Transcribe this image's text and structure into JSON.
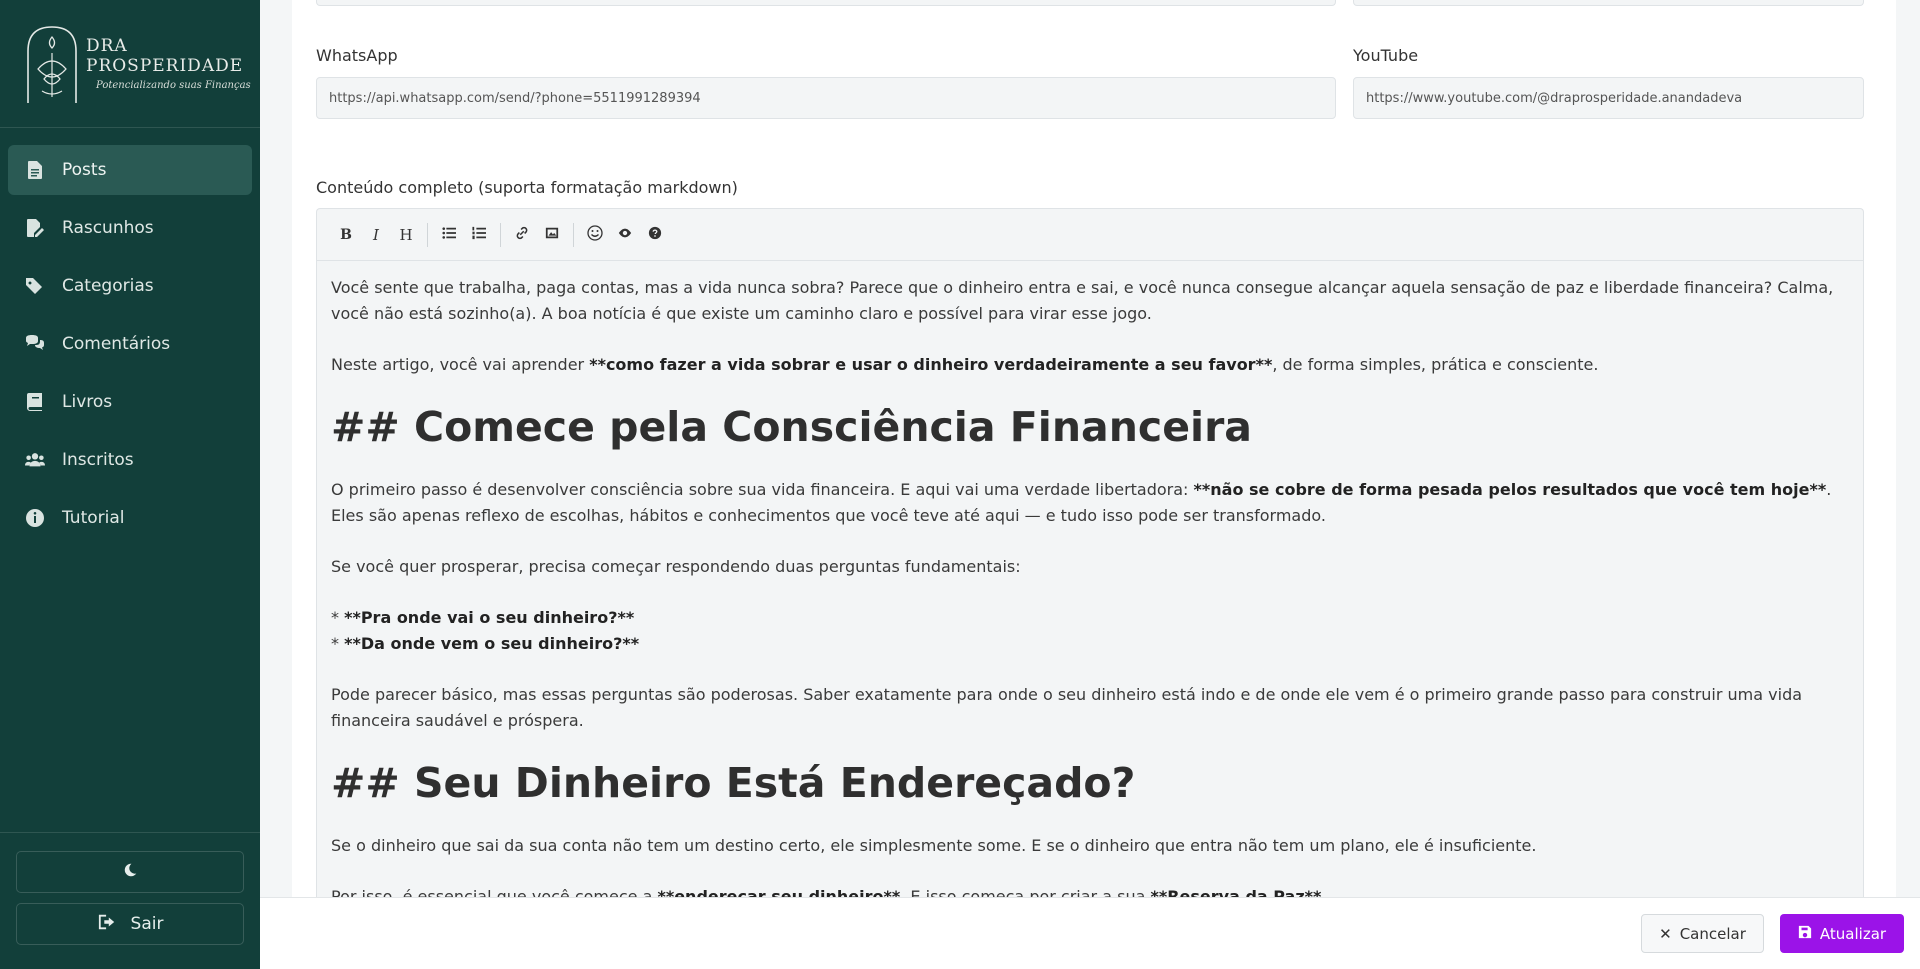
{
  "brand": {
    "title": "DRA PROSPERIDADE",
    "subtitle": "Potencializando suas Finanças"
  },
  "sidebar": {
    "items": [
      {
        "label": "Posts",
        "icon": "file-icon",
        "active": true
      },
      {
        "label": "Rascunhos",
        "icon": "edit-icon",
        "active": false
      },
      {
        "label": "Categorias",
        "icon": "tags-icon",
        "active": false
      },
      {
        "label": "Comentários",
        "icon": "comments-icon",
        "active": false
      },
      {
        "label": "Livros",
        "icon": "book-icon",
        "active": false
      },
      {
        "label": "Inscritos",
        "icon": "users-icon",
        "active": false
      },
      {
        "label": "Tutorial",
        "icon": "info-icon",
        "active": false
      }
    ],
    "theme_toggle_icon": "moon-icon",
    "logout_label": "Sair"
  },
  "form": {
    "whatsapp": {
      "label": "WhatsApp",
      "value": "https://api.whatsapp.com/send/?phone=5511991289394"
    },
    "youtube": {
      "label": "YouTube",
      "value": "https://www.youtube.com/@draprosperidade.anandadeva"
    },
    "content_label": "Conteúdo completo (suporta formatação markdown)"
  },
  "toolbar": {
    "buttons": [
      "bold",
      "italic",
      "heading",
      "unordered-list",
      "ordered-list",
      "link",
      "image",
      "emoji",
      "preview",
      "help"
    ]
  },
  "content": {
    "p1": "Você sente que trabalha, paga contas, mas a vida nunca sobra? Parece que o dinheiro entra e sai, e você nunca consegue alcançar aquela sensação de paz e liberdade financeira? Calma, você não está sozinho(a). A boa notícia é que existe um caminho claro e possível para virar esse jogo.",
    "p2_pre": "Neste artigo, você vai aprender ",
    "p2_bold": "**como fazer a vida sobrar e usar o dinheiro verdadeiramente a seu favor**",
    "p2_post": ", de forma simples, prática e consciente.",
    "h1": "## Comece pela Consciência Financeira",
    "p3_pre": "O primeiro passo é desenvolver consciência sobre sua vida financeira. E aqui vai uma verdade libertadora: ",
    "p3_bold": "**não se cobre de forma pesada pelos resultados que você tem hoje**",
    "p3_post": ". Eles são apenas reflexo de escolhas, hábitos e conhecimentos que você teve até aqui — e tudo isso pode ser transformado.",
    "p4": "Se você quer prosperar, precisa começar respondendo duas perguntas fundamentais:",
    "li1_bullet": "* ",
    "li1": "**Pra onde vai o seu dinheiro?**",
    "li2_bullet": "* ",
    "li2": "**Da onde vem o seu dinheiro?**",
    "p5": "Pode parecer básico, mas essas perguntas são poderosas. Saber exatamente para onde o seu dinheiro está indo e de onde ele vem é o primeiro grande passo para construir uma vida financeira saudável e próspera.",
    "h2": "## Seu Dinheiro Está Endereçado?",
    "p6": "Se o dinheiro que sai da sua conta não tem um destino certo, ele simplesmente some. E se o dinheiro que entra não tem um plano, ele é insuficiente.",
    "p7_pre": "Por isso, é essencial que você comece a ",
    "p7_bold": "**endereçar seu dinheiro**",
    "p7_mid": ". E isso começa por criar a sua ",
    "p7_bold2": "**Reserva da Paz**",
    "p7_post": "."
  },
  "actions": {
    "cancel": "Cancelar",
    "update": "Atualizar"
  },
  "colors": {
    "sidebar_bg": "#123f3a",
    "accent": "#9b13e8"
  }
}
